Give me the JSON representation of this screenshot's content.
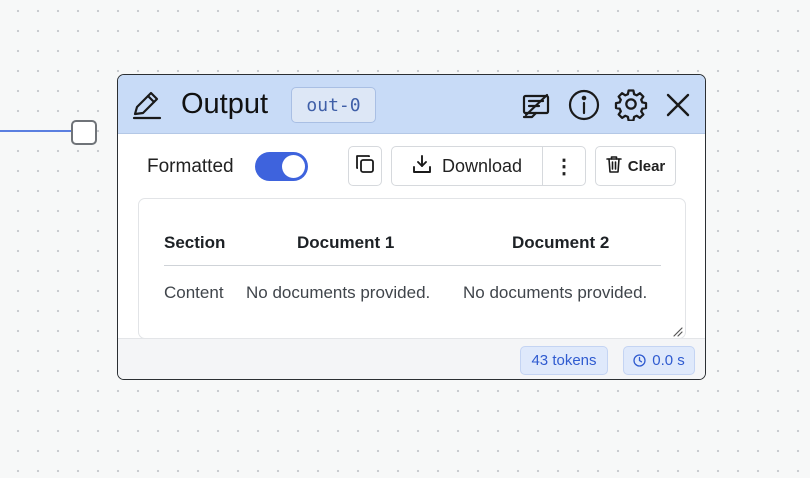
{
  "node": {
    "title": "Output",
    "id": "out-0",
    "header_icons": [
      "pencil-icon",
      "hide-preview-icon",
      "info-icon",
      "gear-icon",
      "close-icon"
    ]
  },
  "toolbar": {
    "format_label": "Formatted",
    "format_enabled": true,
    "download_label": "Download",
    "more_symbol": "⋮",
    "clear_label": "Clear"
  },
  "table": {
    "headers": [
      "Section",
      "Document 1",
      "Document 2"
    ],
    "rows": [
      [
        "Content",
        "No documents provided.",
        "No documents provided."
      ]
    ]
  },
  "footer": {
    "tokens": "43 tokens",
    "time": "0.0 s"
  },
  "colors": {
    "header_bg": "#c8dbf7",
    "accent": "#3e63dd",
    "edge": "#5b7fe0"
  }
}
